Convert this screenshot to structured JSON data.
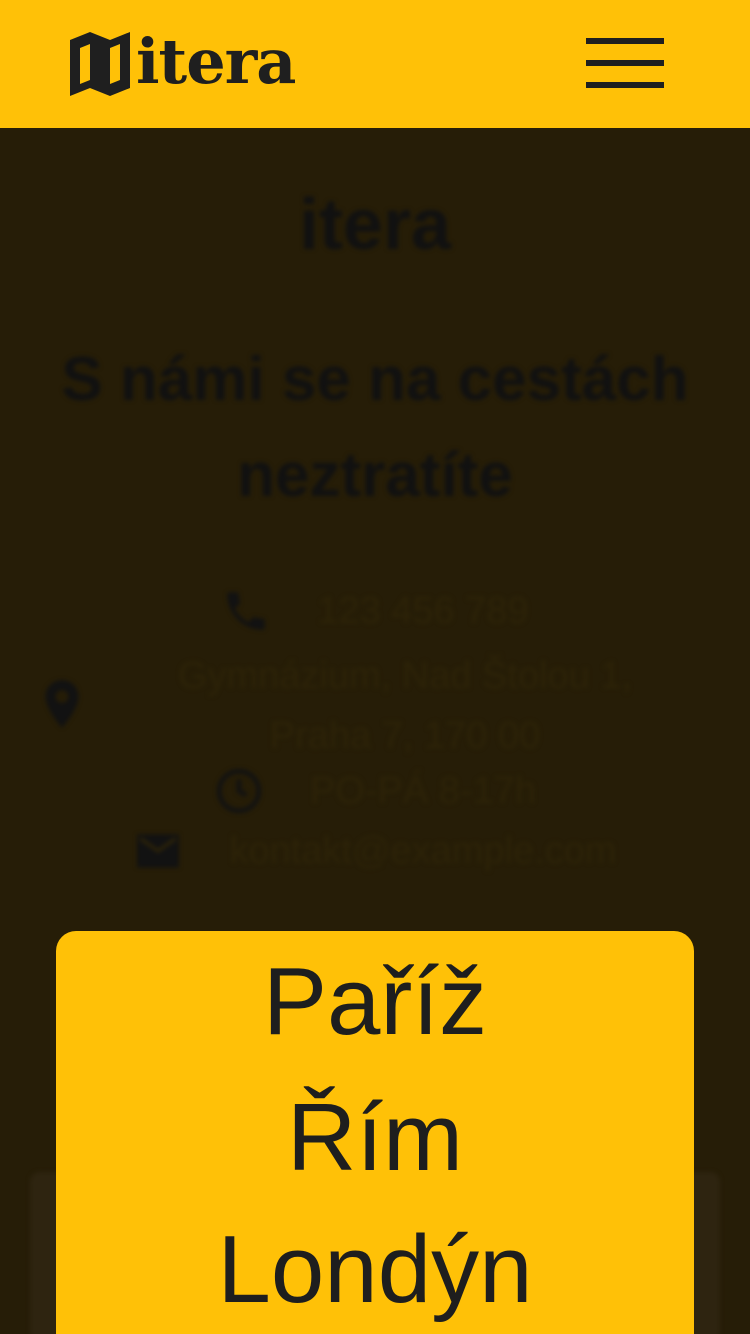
{
  "header": {
    "logo_text": "itera",
    "menu_icon": "hamburger-icon",
    "accent_color": "#ffc107"
  },
  "hero": {
    "title": "itera",
    "tagline": "S námi se na cestách neztratíte"
  },
  "contact": {
    "phone": {
      "icon": "phone-icon",
      "text": "123 456 789"
    },
    "address": {
      "icon": "location-pin-icon",
      "text": "Gymnázium, Nad Štolou 1, Praha 7, 170 00"
    },
    "hours": {
      "icon": "clock-icon",
      "text": "PO-PÁ 8-17h"
    },
    "email": {
      "icon": "mail-icon",
      "text": "kontakt@example.com"
    }
  },
  "menu": {
    "items": [
      {
        "label": "Paříž"
      },
      {
        "label": "Řím"
      },
      {
        "label": "Londýn"
      }
    ]
  },
  "colors": {
    "overlay": "#261d07",
    "text_dark": "#1e1e1e"
  }
}
